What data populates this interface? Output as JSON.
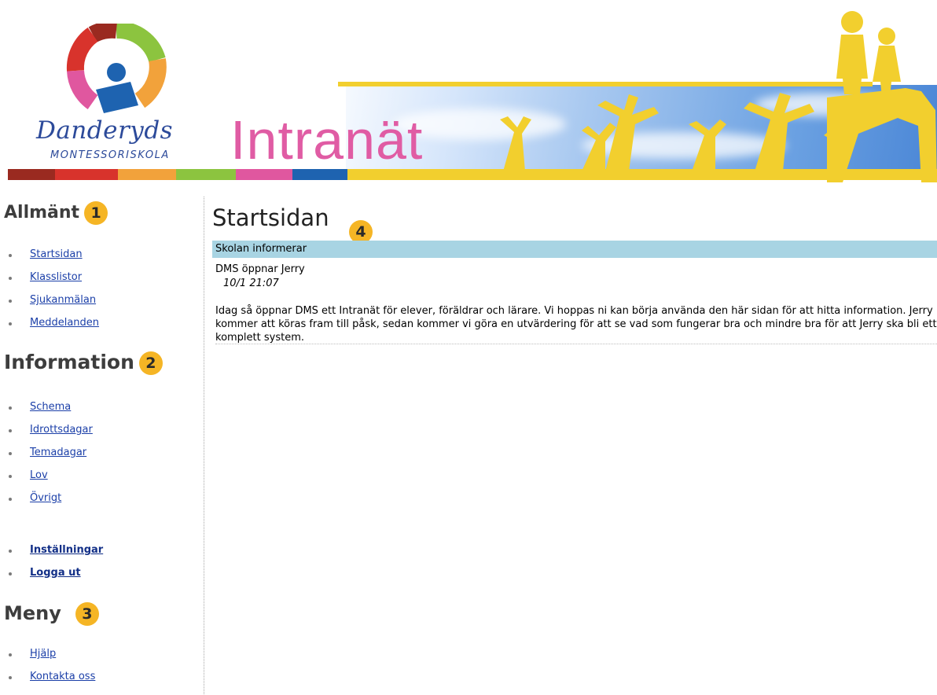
{
  "header": {
    "brand_name": "Danderyds",
    "brand_sub": "MONTESSORISKOLA",
    "site_title": "Intranät",
    "colors": {
      "title_pink": "#e05ca4",
      "brand_blue": "#2c4a9a",
      "gold": "#f2cf2e"
    },
    "color_bar": [
      "#9a2a20",
      "#d8332c",
      "#f2a23b",
      "#8cc43f",
      "#e0579f",
      "#1e63b0"
    ]
  },
  "sidebar": {
    "sections": [
      {
        "heading": "Allmänt",
        "badge": "1",
        "items": [
          "Startsidan",
          "Klasslistor",
          "Sjukanmälan",
          "Meddelanden"
        ]
      },
      {
        "heading": "Information",
        "badge": "2",
        "items": [
          "Schema",
          "Idrottsdagar",
          "Temadagar",
          "Lov",
          "Övrigt"
        ]
      },
      {
        "heading": "Meny",
        "badge": "3",
        "items": [
          "Hjälp",
          "Kontakta oss"
        ]
      }
    ],
    "account_links": [
      "Inställningar",
      "Logga ut"
    ]
  },
  "main": {
    "page_title": "Startsidan",
    "badge": "4",
    "section_bar": "Skolan informerar",
    "post": {
      "title": "DMS öppnar Jerry",
      "timestamp": "10/1 21:07",
      "body": "Idag så öppnar DMS ett Intranät för elever, föräldrar och lärare. Vi hoppas ni kan börja använda den här sidan för att hitta information. Jerry kommer att köras fram till påsk, sedan kommer vi göra en utvärdering för att se vad som fungerar bra och mindre bra för att Jerry ska bli ett komplett system."
    }
  }
}
